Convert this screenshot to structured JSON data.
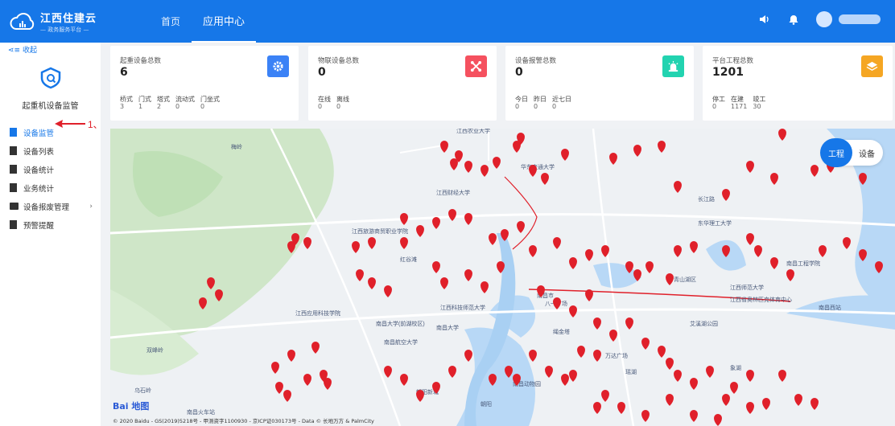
{
  "brand": {
    "title": "江西住建云",
    "subtitle": "— 政务服务平台 —"
  },
  "nav": [
    {
      "label": "首页",
      "active": false
    },
    {
      "label": "应用中心",
      "active": true
    }
  ],
  "top_icons": [
    "speaker-icon",
    "bell-icon",
    "user-avatar"
  ],
  "sidebar": {
    "collapse_label": "收起",
    "module_title": "起重机设备监管",
    "items": [
      {
        "label": "设备监管",
        "active": true,
        "icon": "document-icon"
      },
      {
        "label": "设备列表",
        "active": false,
        "icon": "document-icon"
      },
      {
        "label": "设备统计",
        "active": false,
        "icon": "document-icon"
      },
      {
        "label": "业务统计",
        "active": false,
        "icon": "document-icon"
      },
      {
        "label": "设备报废管理",
        "active": false,
        "icon": "folder-icon",
        "has_submenu": true
      },
      {
        "label": "预警提醒",
        "active": false,
        "icon": "document-icon"
      }
    ],
    "annotation": "1、"
  },
  "cards": [
    {
      "label": "起重设备总数",
      "value": "6",
      "badge_color": "#3b82f6",
      "icon": "gear-icon",
      "stats": [
        {
          "k": "桥式",
          "v": "3"
        },
        {
          "k": "门式",
          "v": "1"
        },
        {
          "k": "塔式",
          "v": "2"
        },
        {
          "k": "流动式",
          "v": "0"
        },
        {
          "k": "门坐式",
          "v": "0"
        }
      ]
    },
    {
      "label": "物联设备总数",
      "value": "0",
      "badge_color": "#f5515f",
      "icon": "network-icon",
      "stats": [
        {
          "k": "在线",
          "v": "0"
        },
        {
          "k": "离线",
          "v": "0"
        }
      ]
    },
    {
      "label": "设备报警总数",
      "value": "0",
      "badge_color": "#22d3b0",
      "icon": "alarm-icon",
      "stats": [
        {
          "k": "今日",
          "v": "0"
        },
        {
          "k": "昨日",
          "v": "0"
        },
        {
          "k": "近七日",
          "v": "0"
        }
      ]
    },
    {
      "label": "平台工程总数",
      "value": "1201",
      "badge_color": "#f5a623",
      "icon": "layers-icon",
      "stats": [
        {
          "k": "停工",
          "v": "0"
        },
        {
          "k": "在建",
          "v": "1171"
        },
        {
          "k": "竣工",
          "v": "30"
        }
      ]
    }
  ],
  "map": {
    "toggle": {
      "on": "工程",
      "off": "设备"
    },
    "logo": "Bai 地图",
    "copyright": "© 2020 Baidu - GS(2019)5218号 - 甲测资字1100930 - 京ICP证030173号 - Data © 长地万方 & PalmCity",
    "labels": [
      "江西农业大学",
      "华东交通大学",
      "江西财经大学",
      "江西旅游商贸职业学院",
      "南昌大学",
      "江西科技师范大学",
      "南昌航空大学",
      "南昌大学(前湖校区)",
      "南昌市",
      "八一广场",
      "青山湖区",
      "万达广场",
      "南昌动物园",
      "江西师范大学",
      "东华理工大学",
      "南昌工程学院",
      "江西省奥林匹克体育中心",
      "南昌西站",
      "红谷滩",
      "绳金塔",
      "朝阳新城",
      "长江路",
      "瑶湖",
      "艾溪湖公园",
      "南昌火车站",
      "江西应用科技学院",
      "双峰岭",
      "乌石岭",
      "梅岭",
      "朝阳",
      "象湖"
    ],
    "marker_color": "#e0202a"
  }
}
